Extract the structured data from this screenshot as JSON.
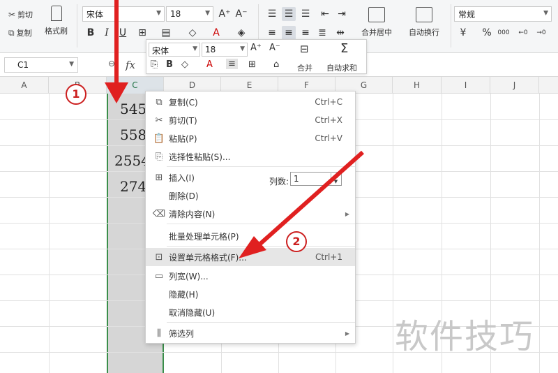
{
  "ribbon": {
    "clipboard": {
      "cut": "剪切",
      "copy": "复制",
      "format_painter": "格式刷"
    },
    "font": {
      "name": "宋体",
      "size": "18"
    },
    "alignment": {
      "merge_center": "合并居中",
      "wrap_text": "自动换行"
    },
    "number": {
      "format": "常规",
      "percent": "%",
      "thousands": "000"
    }
  },
  "formula_bar": {
    "cell_ref": "C1",
    "fx": "fx"
  },
  "grid": {
    "columns": [
      "A",
      "B",
      "C",
      "D",
      "E",
      "F",
      "G",
      "H",
      "I",
      "J"
    ],
    "selected_column": "C",
    "cells": [
      "545",
      "558",
      "2554",
      "274"
    ]
  },
  "mini_toolbar": {
    "font": "宋体",
    "size": "18",
    "merge": "合并",
    "autosum": "自动求和"
  },
  "context_menu": {
    "items": [
      {
        "label": "复制(C)",
        "shortcut": "Ctrl+C"
      },
      {
        "label": "剪切(T)",
        "shortcut": "Ctrl+X"
      },
      {
        "label": "粘贴(P)",
        "shortcut": "Ctrl+V"
      },
      {
        "label": "选择性粘贴(S)...",
        "shortcut": ""
      },
      {
        "label": "插入(I)",
        "shortcut": ""
      },
      {
        "label": "删除(D)",
        "shortcut": ""
      },
      {
        "label": "清除内容(N)",
        "shortcut": ""
      },
      {
        "label": "批量处理单元格(P)",
        "shortcut": ""
      },
      {
        "label": "设置单元格格式(F)...",
        "shortcut": "Ctrl+1"
      },
      {
        "label": "列宽(W)...",
        "shortcut": ""
      },
      {
        "label": "隐藏(H)",
        "shortcut": ""
      },
      {
        "label": "取消隐藏(U)",
        "shortcut": ""
      },
      {
        "label": "筛选列",
        "shortcut": ""
      }
    ],
    "column_count_label": "列数:",
    "column_count_value": "1"
  },
  "annotations": {
    "step1": "1",
    "step2": "2",
    "arrow_color": "#e02020"
  },
  "watermark": "软件技巧",
  "colors": {
    "selection_border": "#3a8e4a",
    "selected_fill": "#d6d6d6",
    "menu_highlight": "#e6e6e6"
  }
}
